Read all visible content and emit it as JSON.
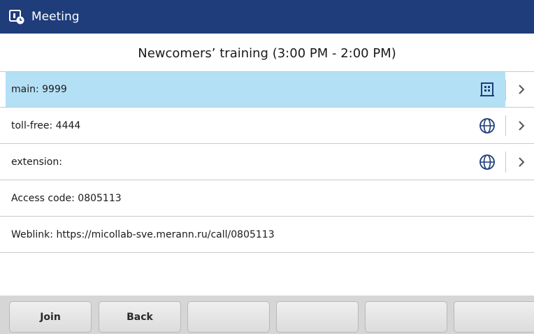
{
  "header": {
    "title": "Meeting",
    "icon": "meeting-clock-icon",
    "background": "#1f3d7a"
  },
  "meeting": {
    "title": "Newcomers’ training (3:00 PM - 2:00 PM)"
  },
  "dial_rows": [
    {
      "label": "main: 9999",
      "icon": "building-icon",
      "selected": true
    },
    {
      "label": "toll-free: 4444",
      "icon": "globe-icon",
      "selected": false
    },
    {
      "label": "extension:",
      "icon": "globe-icon",
      "selected": false
    }
  ],
  "info_rows": {
    "access_code": "Access code: 0805113",
    "weblink": "Weblink: https://micollab-sve.merann.ru/call/0805113"
  },
  "softkeys": {
    "join": "Join",
    "back": "Back",
    "empty": [
      "",
      "",
      "",
      ""
    ]
  },
  "colors": {
    "selected_row": "#b4e0f6",
    "icon_accent": "#1f3d7a"
  }
}
